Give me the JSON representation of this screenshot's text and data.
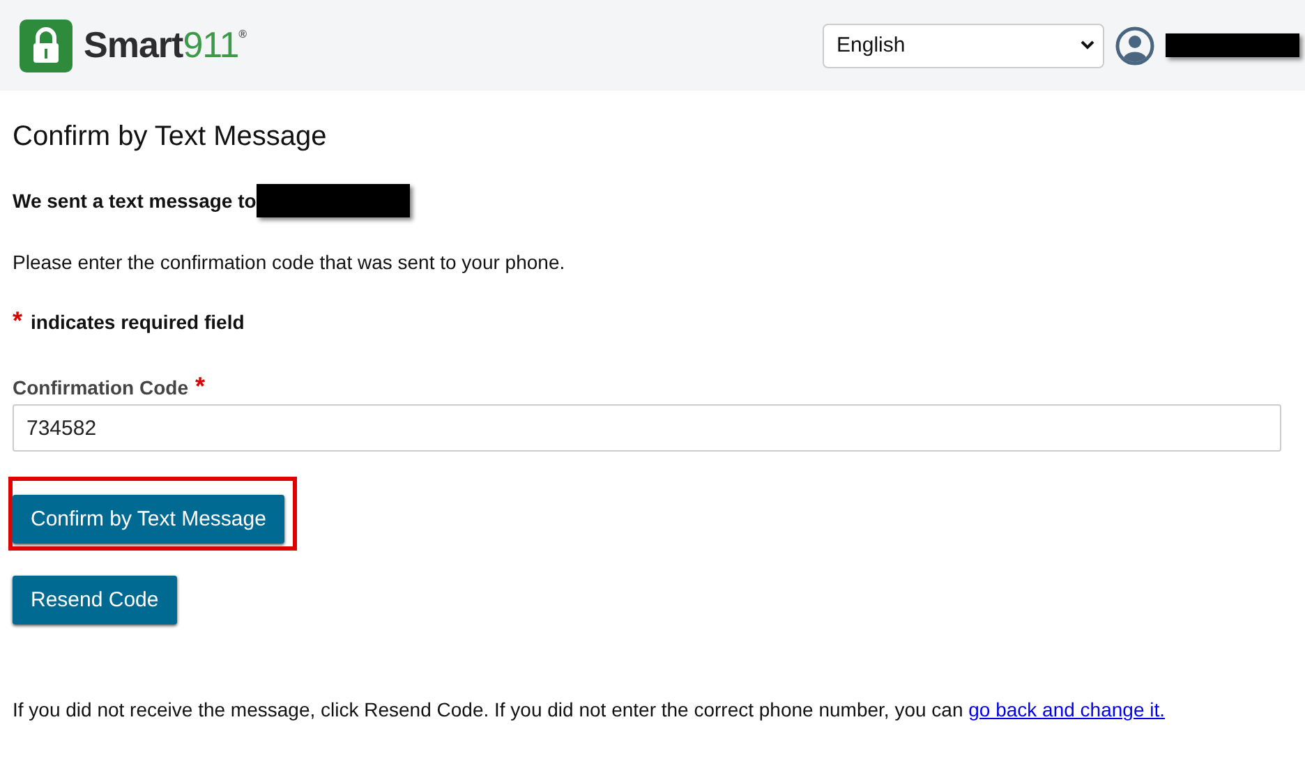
{
  "header": {
    "logo": {
      "word": "Smart",
      "number": "911",
      "mark": "®"
    },
    "language": {
      "value": "English"
    }
  },
  "title": "Confirm by Text Message",
  "sent_notice": "We sent a text message to",
  "instructions": "Please enter the confirmation code that was sent to your phone.",
  "required_note": {
    "asterisk": "*",
    "text": "indicates required field"
  },
  "field": {
    "label": "Confirmation Code",
    "asterisk": "*",
    "value": "734582"
  },
  "buttons": [
    {
      "label": "Confirm by Text Message",
      "highlighted": true
    },
    {
      "label": "Resend Code",
      "highlighted": false
    }
  ],
  "footer": {
    "text": "If you did not receive the message, click Resend Code. If you did not enter the correct phone number, you can",
    "link": "go back and change it."
  }
}
